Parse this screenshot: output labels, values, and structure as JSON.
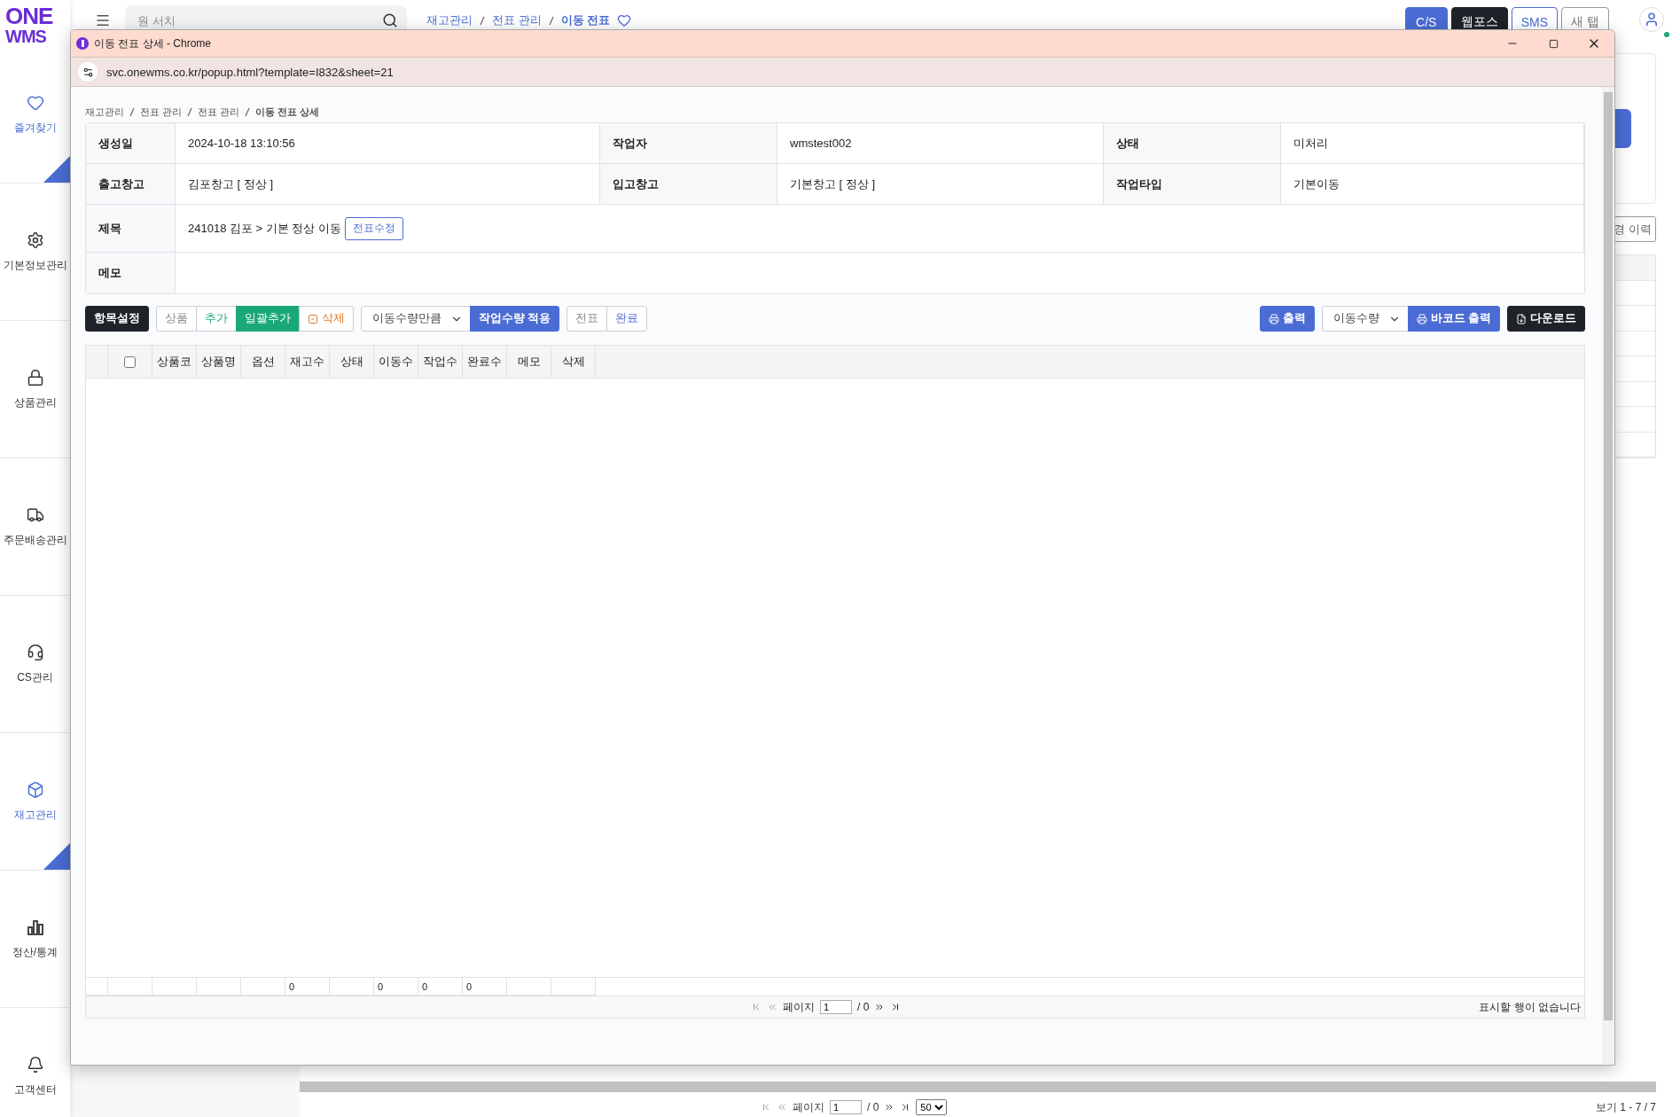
{
  "sidebar": {
    "logo": [
      "ONE",
      "WMS"
    ],
    "items": [
      {
        "label": "즐겨찾기",
        "selected": true
      },
      {
        "label": "기본정보관리",
        "selected": false
      },
      {
        "label": "상품관리",
        "selected": false
      },
      {
        "label": "주문배송관리",
        "selected": false
      },
      {
        "label": "CS관리",
        "selected": false
      },
      {
        "label": "재고관리",
        "selected": true
      },
      {
        "label": "정산/통계",
        "selected": false
      },
      {
        "label": "고객센터",
        "selected": false
      }
    ]
  },
  "topbar": {
    "search": {
      "placeholder": "원 서치"
    },
    "breadcrumb": [
      "재고관리",
      "전표 관리",
      "이동 전표"
    ],
    "buttons": [
      {
        "label": "C/S",
        "kind": "primary"
      },
      {
        "label": "웹포스",
        "kind": "dark"
      },
      {
        "label": "SMS",
        "kind": "outline"
      },
      {
        "label": "새 탭",
        "kind": "plain"
      }
    ],
    "online": true
  },
  "page": {
    "history_button": "경 이력",
    "pager": {
      "label": "페이지",
      "page": "1",
      "total": "/ 0",
      "per_page": "50",
      "summary": "보기 1 - 7 / 7"
    }
  },
  "popup": {
    "title": "이동 전표 상세 - Chrome",
    "url": "svc.onewms.co.kr/popup.html?template=I832&sheet=21",
    "breadcrumb": [
      "재고관리",
      "전표 관리",
      "전표 관리",
      "이동 전표 상세"
    ],
    "info": [
      [
        {
          "label": "생성일",
          "value": "2024-10-18 13:10:56"
        },
        {
          "label": "작업자",
          "value": "wmstest002"
        },
        {
          "label": "상태",
          "value": "미처리"
        }
      ],
      [
        {
          "label": "출고창고",
          "value": "김포창고 [ 정상 ]"
        },
        {
          "label": "입고창고",
          "value": "기본창고 [ 정상 ]"
        },
        {
          "label": "작업타입",
          "value": "기본이동"
        }
      ],
      [
        {
          "label": "제목",
          "value": "241018 김포 > 기본 정상 이동",
          "button": "전표수정"
        }
      ],
      [
        {
          "label": "메모"
        }
      ]
    ],
    "toolbar": {
      "left": [
        [
          {
            "label": "항목설정",
            "kind": "dark"
          }
        ],
        [
          {
            "label": "상품",
            "kind": "muted"
          },
          {
            "label": "추가",
            "kind": "add"
          },
          {
            "label": "일괄추가",
            "kind": "bulk"
          },
          {
            "label": "삭제",
            "kind": "delete"
          }
        ],
        [
          {
            "label": "이동수량만큼",
            "kind": "select"
          },
          {
            "label": "작업수량 적용",
            "kind": "primary"
          }
        ],
        [
          {
            "label": "전표",
            "kind": "muted"
          },
          {
            "label": "완료",
            "kind": "link"
          }
        ]
      ],
      "right": [
        [
          {
            "label": "출력",
            "kind": "print"
          }
        ],
        [
          {
            "label": "이동수량",
            "kind": "select"
          },
          {
            "label": "바코드 출력",
            "kind": "print"
          }
        ],
        [
          {
            "label": "다운로드",
            "kind": "download"
          }
        ]
      ]
    },
    "grid": {
      "select_all": {
        "checked": false
      },
      "columns": [
        {
          "label": "상품코"
        },
        {
          "label": "상품명"
        },
        {
          "label": "옵션"
        },
        {
          "label": "재고수",
          "total": "0"
        },
        {
          "label": "상태"
        },
        {
          "label": "이동수",
          "total": "0"
        },
        {
          "label": "작업수",
          "total": "0"
        },
        {
          "label": "완료수",
          "total": "0"
        },
        {
          "label": "메모"
        },
        {
          "label": "삭제"
        }
      ]
    },
    "pager": {
      "label": "페이지",
      "page": "1",
      "total": "/ 0",
      "empty_message": "표시할 행이 없습니다"
    }
  }
}
